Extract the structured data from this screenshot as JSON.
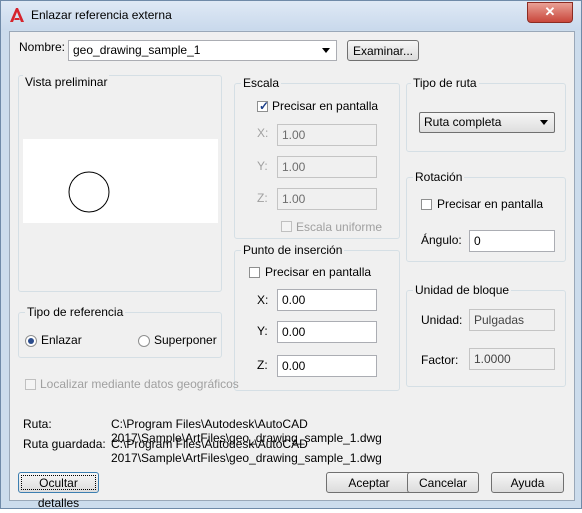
{
  "window": {
    "title": "Enlazar referencia externa",
    "close_glyph": "✕"
  },
  "name_row": {
    "label": "Nombre:",
    "value": "geo_drawing_sample_1",
    "browse_button": "Examinar..."
  },
  "preview": {
    "label": "Vista preliminar"
  },
  "scale": {
    "label": "Escala",
    "specify_on_screen": "Precisar en pantalla",
    "specify_checked": true,
    "x_label": "X:",
    "x_value": "1.00",
    "y_label": "Y:",
    "y_value": "1.00",
    "z_label": "Z:",
    "z_value": "1.00",
    "uniform_label": "Escala uniforme"
  },
  "path_type": {
    "label": "Tipo de ruta",
    "value": "Ruta completa"
  },
  "insertion": {
    "label": "Punto de inserción",
    "specify_on_screen": "Precisar en pantalla",
    "x_label": "X:",
    "x_value": "0.00",
    "y_label": "Y:",
    "y_value": "0.00",
    "z_label": "Z:",
    "z_value": "0.00"
  },
  "rotation": {
    "label": "Rotación",
    "specify_on_screen": "Precisar en pantalla",
    "angle_label": "Ángulo:",
    "angle_value": "0"
  },
  "block_unit": {
    "label": "Unidad de bloque",
    "unit_label": "Unidad:",
    "unit_value": "Pulgadas",
    "factor_label": "Factor:",
    "factor_value": "1.0000"
  },
  "ref_type": {
    "label": "Tipo de referencia",
    "attach": "Enlazar",
    "overlay": "Superponer"
  },
  "geo_locate": "Localizar mediante datos geográficos",
  "paths": {
    "path_label": "Ruta:",
    "path_value": "C:\\Program Files\\Autodesk\\AutoCAD 2017\\Sample\\ArtFiles\\geo_drawing_sample_1.dwg",
    "saved_label": "Ruta guardada:",
    "saved_value": "C:\\Program Files\\Autodesk\\AutoCAD 2017\\Sample\\ArtFiles\\geo_drawing_sample_1.dwg"
  },
  "buttons": {
    "hide_details": "Ocultar detalles",
    "ok": "Aceptar",
    "cancel": "Cancelar",
    "help": "Ayuda"
  },
  "colors": {
    "title_bg": "#c9d9ec",
    "dialog_bg": "#f0f0f0",
    "close_red": "#c9473c",
    "app_icon_red": "#d6232c"
  }
}
